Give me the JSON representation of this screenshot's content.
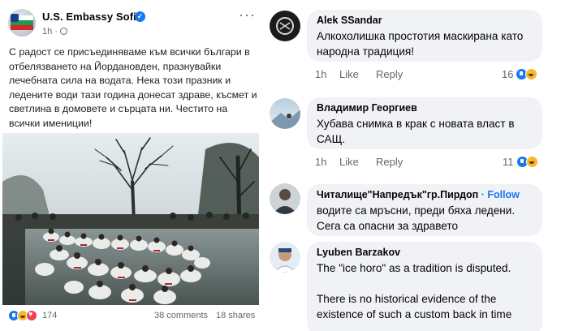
{
  "post": {
    "page_name": "U.S. Embassy Sofia",
    "time": "1h",
    "text": "С радост се присъединяваме към всички българи в отбелязването на Йордановден, празнувайки лечебната сила на водата. Нека този празник и ледените води тази година донесат здраве, късмет и светлина в домовете и сърцата ни. Честито на всички имениции!",
    "reactions_count": "174",
    "comments_count": "38 comments",
    "shares_count": "18 shares"
  },
  "comments": [
    {
      "author": "Alek SSandar",
      "text": "Алкохолишка простотия маскирана като народна традиция!",
      "time": "1h",
      "like_label": "Like",
      "reply_label": "Reply",
      "reaction_count": "16"
    },
    {
      "author": "Владимир Георгиев",
      "text": "Хубава снимка в крак с новата власт в САЩ.",
      "time": "1h",
      "like_label": "Like",
      "reply_label": "Reply",
      "reaction_count": "11"
    },
    {
      "author": "Читалище\"Напредък\"гр.Пирдоп",
      "follow_label": "· Follow",
      "text": "водите са мръсни, преди бяха ледени.\nСега са опасни за здравето"
    },
    {
      "author": "Lyuben Barzakov",
      "text": "The \"ice horo\" as a tradition is disputed.\n\nThere is no historical evidence of the existence of such a custom back in time"
    }
  ],
  "colors": {
    "accent": "#1877f2",
    "bubble": "#f0f2f5",
    "muted": "#65676b"
  },
  "icons": [
    "verified-icon",
    "globe-icon",
    "more-icon",
    "like-reaction-icon",
    "haha-reaction-icon",
    "love-reaction-icon"
  ]
}
